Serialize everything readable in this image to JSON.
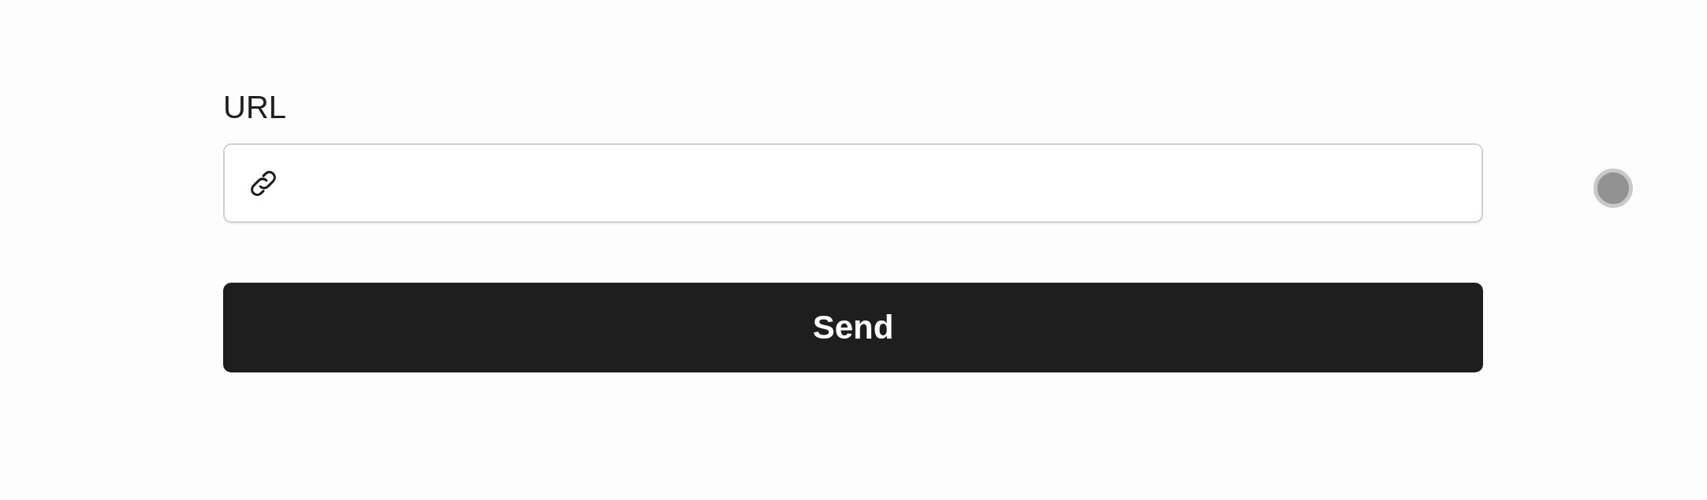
{
  "form": {
    "label": "URL",
    "button": "Send"
  }
}
